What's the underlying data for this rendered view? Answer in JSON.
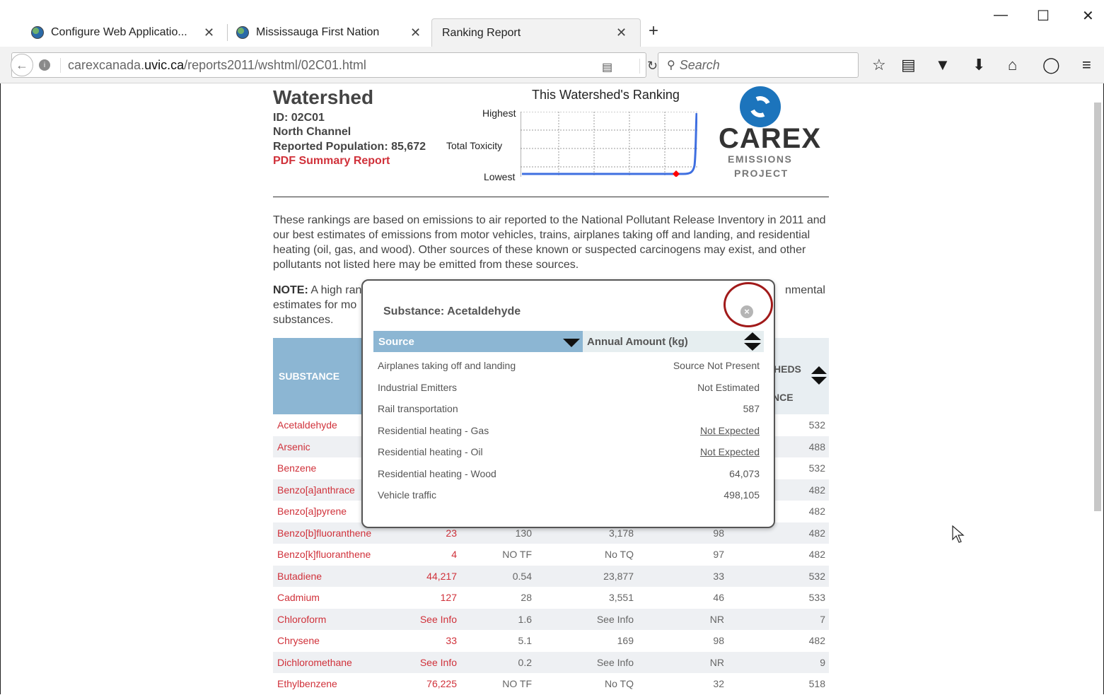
{
  "browser": {
    "tabs": [
      {
        "title": "Configure Web Applicatio...",
        "close": "✕"
      },
      {
        "title": "Mississauga First Nation",
        "close": "✕"
      },
      {
        "title": "Ranking Report",
        "close": "✕"
      }
    ],
    "new_tab": "+",
    "window_controls": [
      "—",
      "☐",
      "✕"
    ],
    "url_prefix": "carexcanada.",
    "url_domain": "uvic.ca",
    "url_path": "/reports2011/wshtml/02C01.html",
    "search_placeholder": "Search",
    "toolbar_icons": [
      "bookmark-star-icon",
      "reading-list-icon",
      "pocket-icon",
      "download-icon",
      "home-icon",
      "chat-icon",
      "menu-icon"
    ]
  },
  "watershed": {
    "title": "Watershed",
    "id": "ID: 02C01",
    "name": "North Channel",
    "population": "Reported Population: 85,672",
    "pdf_link": "PDF Summary Report"
  },
  "ranking_chart": {
    "title": "This Watershed's Ranking",
    "y_top": "Highest",
    "y_mid": "Total Toxicity",
    "y_bottom": "Lowest"
  },
  "chart_data": {
    "type": "line",
    "title": "This Watershed's Ranking",
    "ylabel": "Total Toxicity",
    "tick_labels": [
      "Highest",
      "Lowest"
    ],
    "grid": true,
    "marker_color": "#ff0000",
    "line_color": "#3f6fe0"
  },
  "logo": {
    "name": "CAREX",
    "line1": "EMISSIONS",
    "line2": "PROJECT"
  },
  "intro": {
    "text": "These rankings are based on emissions to air reported to the National Pollutant Release Inventory in 2011 and our best estimates of emissions from motor vehicles, trains, airplanes taking off and landing, and residential heating (oil, gas, and wood). Other sources of these known or suspected carcinogens may exist, and other pollutants not listed here may be emitted from these sources.",
    "note_label": "NOTE:",
    "note_start": " A high ran",
    "note_end": "nmental",
    "note_line2": "estimates for mo",
    "note_line3": "substances."
  },
  "table": {
    "header_substance": "SUBSTANCE",
    "header_right_1": "HEDS",
    "header_right_2": "NCE",
    "rows": [
      {
        "name": "Acetaldehyde",
        "v1": "",
        "v2": "",
        "v3": "",
        "v4": "",
        "v5": "532"
      },
      {
        "name": "Arsenic",
        "v1": "",
        "v2": "",
        "v3": "",
        "v4": "",
        "v5": "488"
      },
      {
        "name": "Benzene",
        "v1": "",
        "v2": "",
        "v3": "",
        "v4": "",
        "v5": "532"
      },
      {
        "name": "Benzo[a]anthrace",
        "v1": "",
        "v2": "",
        "v3": "",
        "v4": "",
        "v5": "482"
      },
      {
        "name": "Benzo[a]pyrene",
        "v1": "",
        "v2": "",
        "v3": "",
        "v4": "",
        "v5": "482"
      },
      {
        "name": "Benzo[b]fluoranthene",
        "v1": "23",
        "v2": "130",
        "v3": "3,178",
        "v4": "98",
        "v5": "482"
      },
      {
        "name": "Benzo[k]fluoranthene",
        "v1": "4",
        "v2": "NO TF",
        "v3": "No TQ",
        "v4": "97",
        "v5": "482"
      },
      {
        "name": "Butadiene",
        "v1": "44,217",
        "v2": "0.54",
        "v3": "23,877",
        "v4": "33",
        "v5": "532"
      },
      {
        "name": "Cadmium",
        "v1": "127",
        "v2": "28",
        "v3": "3,551",
        "v4": "46",
        "v5": "533"
      },
      {
        "name": "Chloroform",
        "v1": "See Info",
        "v2": "1.6",
        "v3": "See Info",
        "v4": "NR",
        "v5": "7"
      },
      {
        "name": "Chrysene",
        "v1": "33",
        "v2": "5.1",
        "v3": "169",
        "v4": "98",
        "v5": "482"
      },
      {
        "name": "Dichloromethane",
        "v1": "See Info",
        "v2": "0.2",
        "v3": "See Info",
        "v4": "NR",
        "v5": "9"
      },
      {
        "name": "Ethylbenzene",
        "v1": "76,225",
        "v2": "NO TF",
        "v3": "No TQ",
        "v4": "32",
        "v5": "518"
      }
    ]
  },
  "popup": {
    "title": "Substance: Acetaldehyde",
    "close_glyph": "×",
    "col_source": "Source",
    "col_amount": "Annual Amount (kg)",
    "rows": [
      {
        "source": "Airplanes taking off and landing",
        "amount": "Source Not Present",
        "link": false
      },
      {
        "source": "Industrial Emitters",
        "amount": "Not Estimated",
        "link": false
      },
      {
        "source": "Rail transportation",
        "amount": "587",
        "link": false
      },
      {
        "source": "Residential heating - Gas",
        "amount": "Not Expected",
        "link": true
      },
      {
        "source": "Residential heating - Oil",
        "amount": "Not Expected",
        "link": true
      },
      {
        "source": "Residential heating - Wood",
        "amount": "64,073",
        "link": false
      },
      {
        "source": "Vehicle traffic",
        "amount": "498,105",
        "link": false
      }
    ]
  }
}
